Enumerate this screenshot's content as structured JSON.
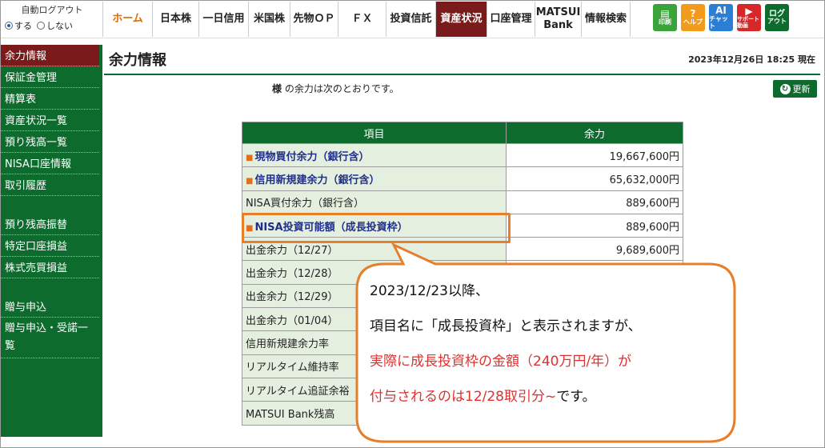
{
  "autologout": {
    "title": "自動ログアウト",
    "on_label": "する",
    "off_label": "しない"
  },
  "nav": {
    "home": "ホーム",
    "jp_stock": "日本株",
    "day_margin": "一日信用",
    "us_stock": "米国株",
    "futures_options": "先物ＯＰ",
    "fx": "ＦＸ",
    "fund": "投資信託",
    "assets": "資産状況",
    "account": "口座管理",
    "bank_line1": "MATSUI",
    "bank_line2": "Bank",
    "info": "情報検索"
  },
  "icons": {
    "print": "印刷",
    "help_glyph": "?",
    "help": "ヘルプ",
    "ai_glyph": "AI",
    "ai_chat": "チャット",
    "support": "サポート動画",
    "logout_line1": "ログ",
    "logout_line2": "アウト"
  },
  "sidebar": {
    "items": [
      "余力情報",
      "保証金管理",
      "精算表",
      "資産状況一覧",
      "預り残高一覧",
      "NISA口座情報",
      "取引履歴",
      "預り残高振替",
      "特定口座損益",
      "株式売買損益",
      "贈与申込",
      "贈与申込・受諾一覧"
    ]
  },
  "page": {
    "title": "余力情報",
    "timestamp": "2023年12月26日 18:25 現在",
    "intro_bold": "様",
    "intro_text": " の余力は次のとおりです。",
    "refresh": "更新"
  },
  "table": {
    "headers": [
      "項目",
      "余力"
    ],
    "rows": [
      {
        "label": "現物買付余力（銀行含）",
        "value": "19,667,600円"
      },
      {
        "label": "信用新規建余力（銀行含）",
        "value": "65,632,000円"
      },
      {
        "label": "NISA買付余力（銀行含）",
        "value": "889,600円"
      },
      {
        "label": "NISA投資可能額（成長投資枠）",
        "value": "889,600円"
      },
      {
        "label": "出金余力（12/27）",
        "value": "9,689,600円"
      },
      {
        "label": "出金余力（12/28）",
        "value": ""
      },
      {
        "label": "出金余力（12/29）",
        "value": ""
      },
      {
        "label": "出金余力（01/04）",
        "value": ""
      },
      {
        "label": "信用新規建余力率",
        "value": ""
      },
      {
        "label": "リアルタイム維持率",
        "value": ""
      },
      {
        "label": "リアルタイム追証余裕",
        "value": ""
      },
      {
        "label": "MATSUI Bank残高",
        "value": ""
      }
    ]
  },
  "callout": {
    "line1": "2023/12/23以降、",
    "line2": "項目名に「成長投資枠」と表示されますが、",
    "line3": "実際に成長投資枠の金額（240万円/年）が",
    "line4a": "付与されるのは12/28取引分~",
    "line4b": "です。"
  },
  "colors": {
    "green": "#0e6b2e",
    "active": "#7a1a1a",
    "accent": "#e67e2a",
    "red_text": "#e03030"
  }
}
